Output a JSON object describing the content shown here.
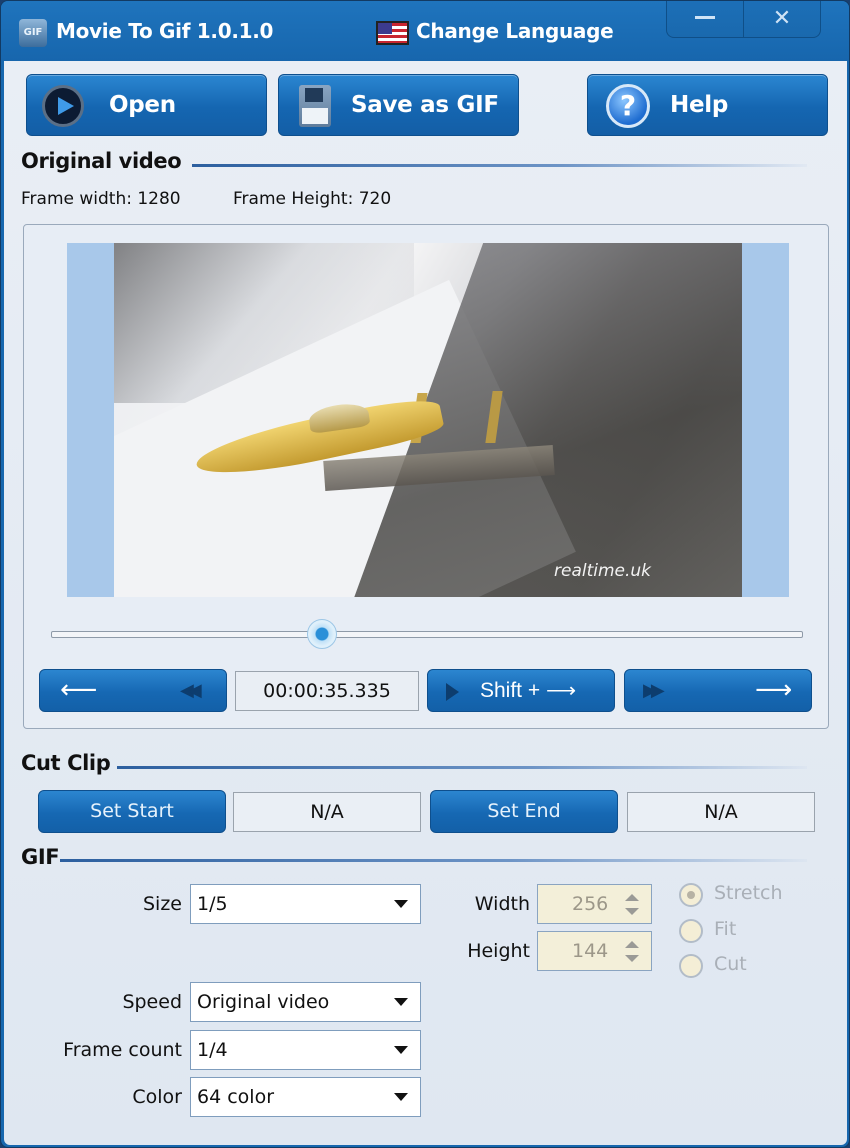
{
  "window": {
    "title": "Movie To Gif 1.0.1.0",
    "app_icon_text": "GIF",
    "change_language_label": "Change Language",
    "minimize_label": "–",
    "close_label": "✕"
  },
  "toolbar": {
    "open_label": "Open",
    "save_label": "Save as GIF",
    "help_label": "Help",
    "help_icon_glyph": "?"
  },
  "original_video": {
    "section_title": "Original video",
    "frame_width_label": "Frame width: 1280",
    "frame_height_label": "Frame Height: 720",
    "watermark": "realtime.uk",
    "slider_position_fraction": 0.36,
    "timecode": "00:00:35.335",
    "prev_arrow": "⟵",
    "rewind_glyph": "◀◀",
    "shift_label": "Shift + ⟶",
    "forward_glyph": "▶▶",
    "next_arrow": "⟶"
  },
  "cut_clip": {
    "section_title": "Cut Clip",
    "set_start_label": "Set Start",
    "start_value": "N/A",
    "set_end_label": "Set End",
    "end_value": "N/A"
  },
  "gif": {
    "section_title": "GIF",
    "size": {
      "label": "Size",
      "value": "1/5"
    },
    "width": {
      "label": "Width",
      "value": "256"
    },
    "height": {
      "label": "Height",
      "value": "144"
    },
    "resize_modes": [
      {
        "label": "Stretch",
        "checked": true
      },
      {
        "label": "Fit",
        "checked": false
      },
      {
        "label": "Cut",
        "checked": false
      }
    ],
    "speed": {
      "label": "Speed",
      "value": "Original video"
    },
    "frame_count": {
      "label": "Frame count",
      "value": "1/4"
    },
    "color": {
      "label": "Color",
      "value": "64 color"
    }
  }
}
